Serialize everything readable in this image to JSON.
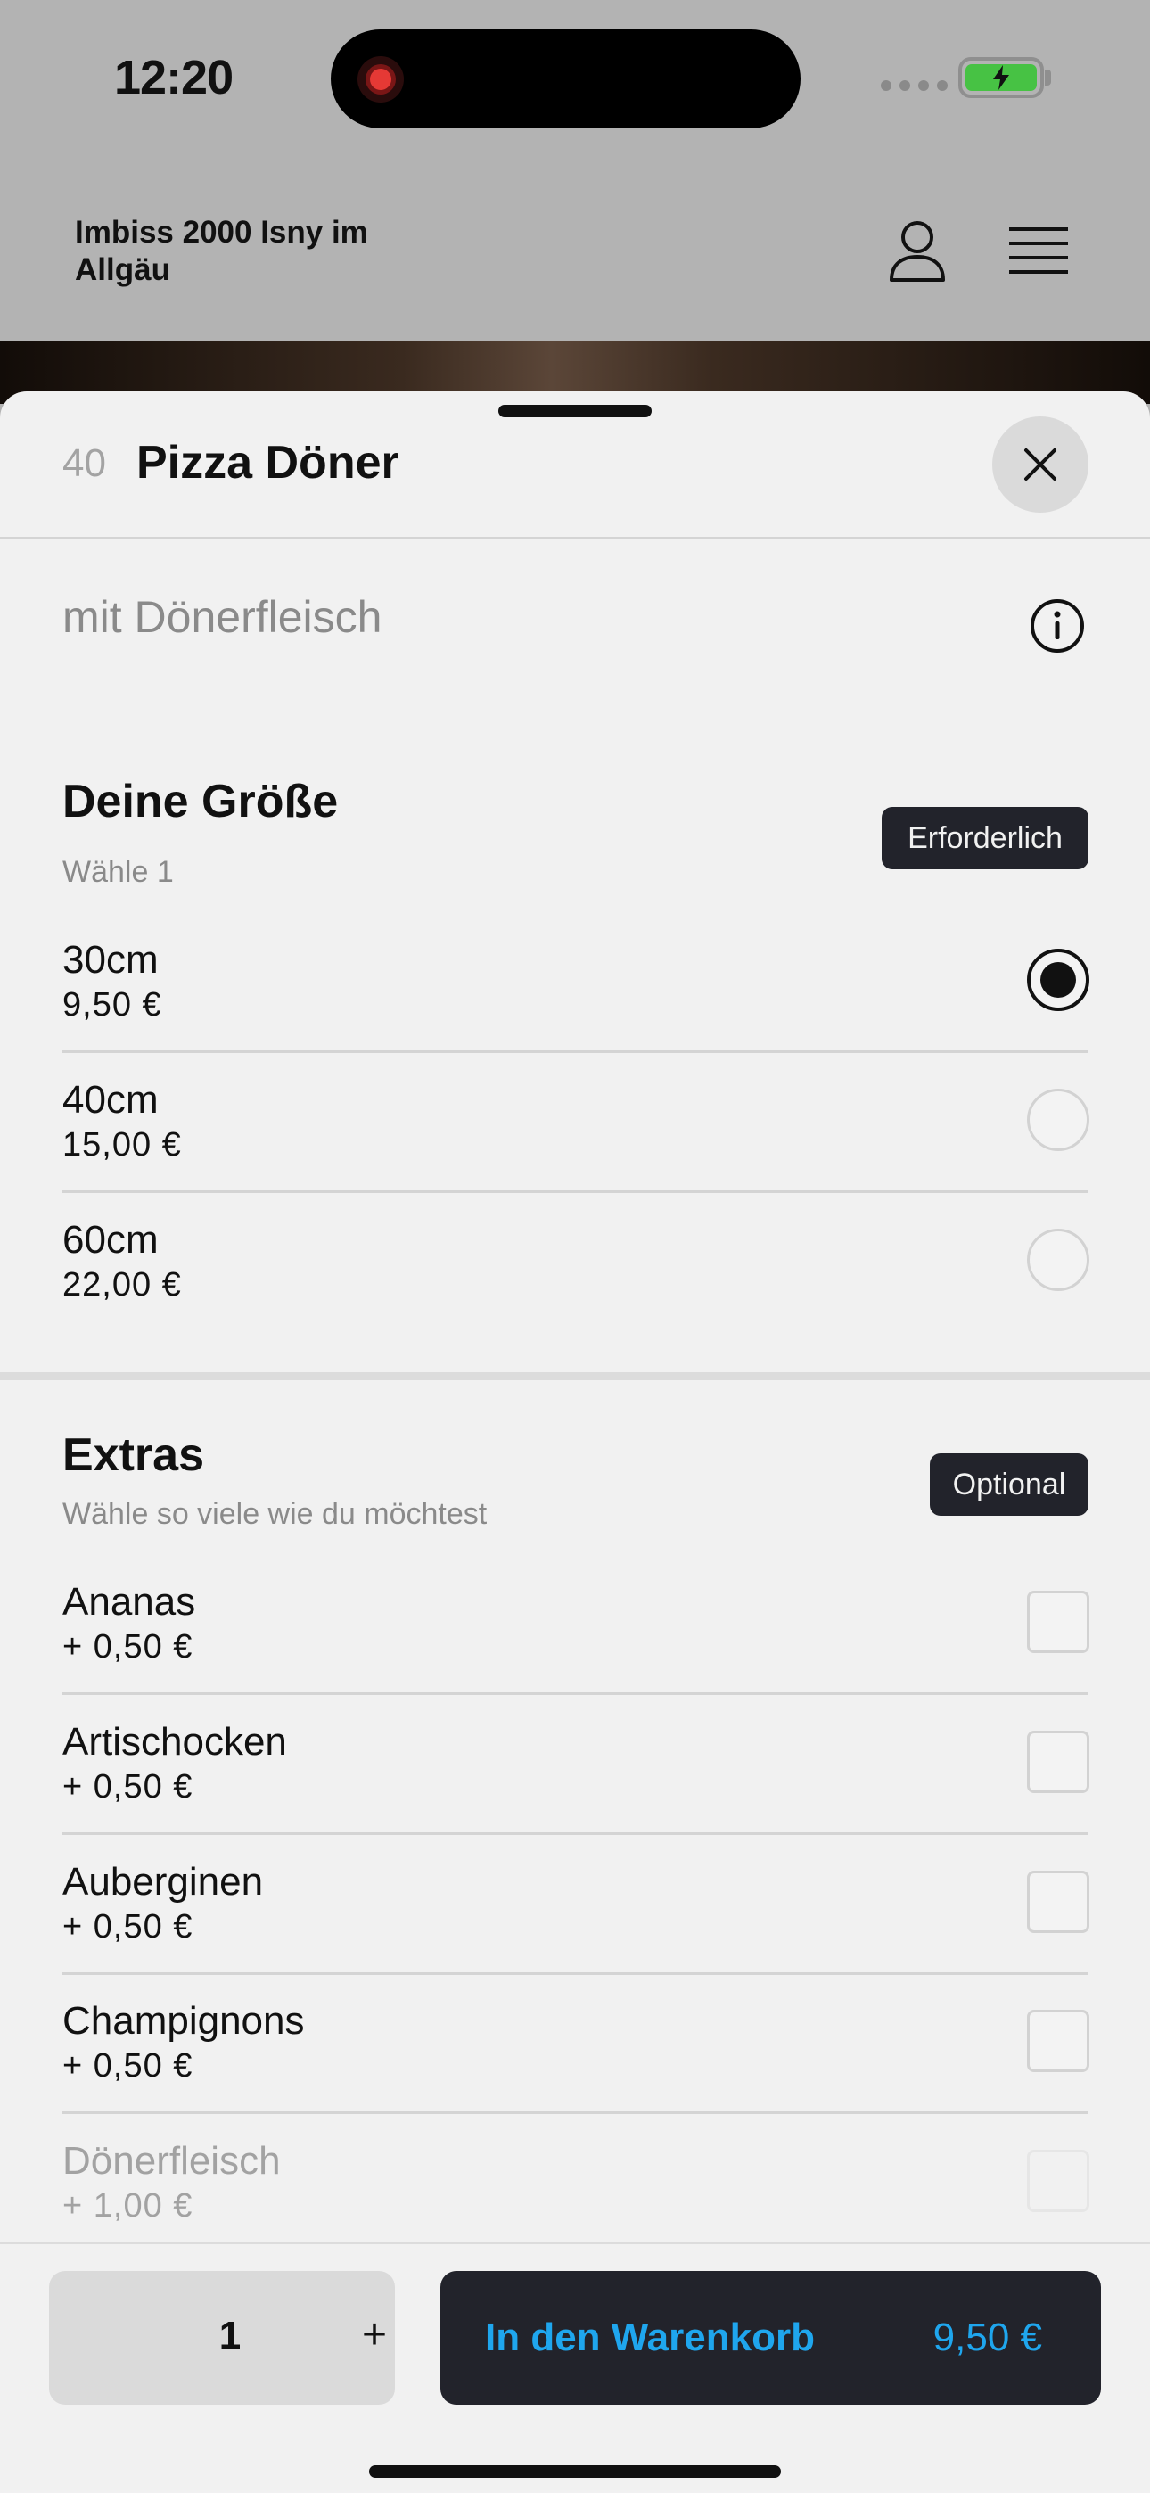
{
  "status_bar": {
    "time": "12:20"
  },
  "header": {
    "shop_name": "Imbiss 2000 Isny im Allgäu"
  },
  "item": {
    "number": "40",
    "title": "Pizza Döner",
    "description": "mit Dönerfleisch"
  },
  "size_section": {
    "title": "Deine Größe",
    "subtitle": "Wähle 1",
    "badge": "Erforderlich",
    "options": [
      {
        "name": "30cm",
        "price": "9,50 €",
        "selected": true
      },
      {
        "name": "40cm",
        "price": "15,00 €",
        "selected": false
      },
      {
        "name": "60cm",
        "price": "22,00 €",
        "selected": false
      }
    ]
  },
  "extras_section": {
    "title": "Extras",
    "subtitle": "Wähle so viele wie du möchtest",
    "badge": "Optional",
    "options": [
      {
        "name": "Ananas",
        "price": "+ 0,50 €",
        "checked": false
      },
      {
        "name": "Artischocken",
        "price": "+ 0,50 €",
        "checked": false
      },
      {
        "name": "Auberginen",
        "price": "+ 0,50 €",
        "checked": false
      },
      {
        "name": "Champignons",
        "price": "+ 0,50 €",
        "checked": false
      },
      {
        "name": "Dönerfleisch",
        "price": "+ 1,00 €",
        "checked": false
      }
    ]
  },
  "footer": {
    "quantity": "1",
    "plus": "+",
    "cart_label": "In den Warenkorb",
    "cart_price": "9,50 €"
  },
  "colors": {
    "accent": "#1fa6ee",
    "dark_button": "#22232b",
    "battery": "#47c244"
  }
}
